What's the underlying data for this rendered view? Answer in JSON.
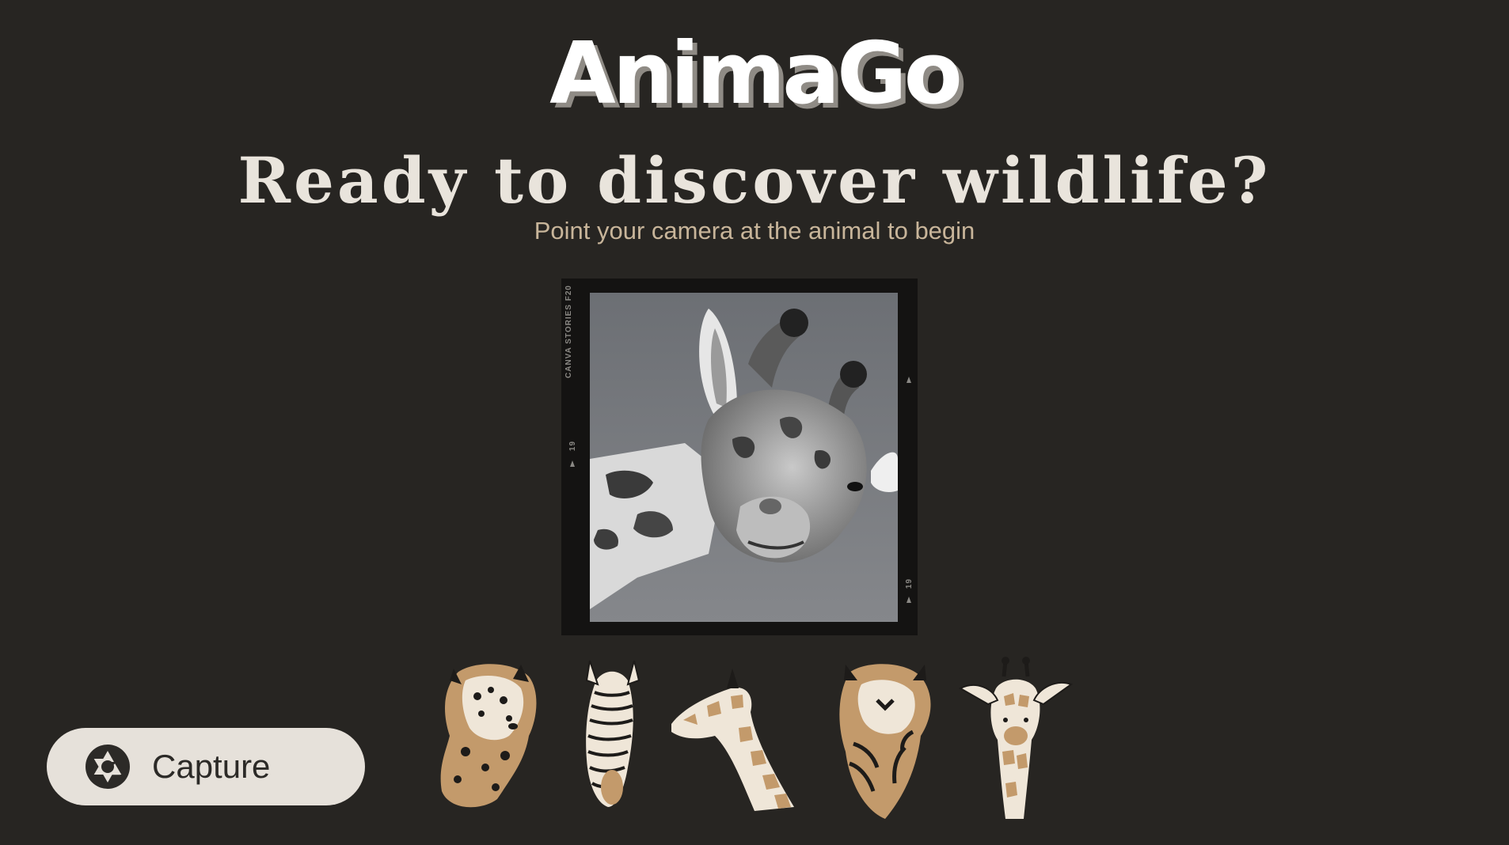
{
  "app": {
    "logo_text": "AnimaGo"
  },
  "hero": {
    "headline": "Ready to discover wildlife?",
    "subtitle": "Point your camera at the animal to begin"
  },
  "photo_frame": {
    "brand_text": "CANVA STORIES F20",
    "frame_number_left": "19",
    "frame_number_right": "19",
    "subject": "giraffe"
  },
  "capture_button": {
    "label": "Capture",
    "icon": "camera-shutter-icon"
  },
  "animal_illustrations": [
    {
      "name": "leopard"
    },
    {
      "name": "zebra"
    },
    {
      "name": "giraffe-neck"
    },
    {
      "name": "tiger"
    },
    {
      "name": "giraffe"
    }
  ],
  "colors": {
    "background": "#272522",
    "headline": "#e9e4dc",
    "subtitle": "#c8b59a",
    "button_bg": "#e6e1da",
    "animal_tan": "#c39a6b",
    "animal_cream": "#efe6d8"
  }
}
